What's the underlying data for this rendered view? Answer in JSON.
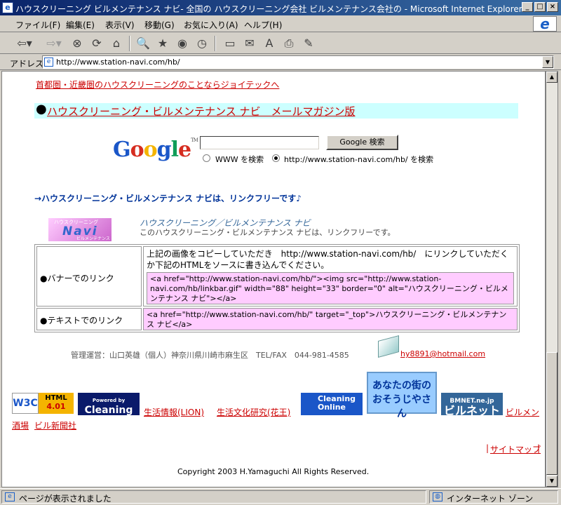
{
  "window": {
    "title": "ハウスクリーニング ビルメンテナンス ナビ- 全国の ハウスクリーニング会社 ビルメンテナンス会社の - Microsoft Internet Explorer"
  },
  "menu": [
    "ファイル(F)",
    "編集(E)",
    "表示(V)",
    "移動(G)",
    "お気に入り(A)",
    "ヘルプ(H)"
  ],
  "address": {
    "label": "アドレス",
    "url": "http://www.station-navi.com/hb/"
  },
  "page": {
    "top_link": "首都圏・近畿圏のハウスクリーニングのことならジョイテックへ",
    "mailmag_link": "ハウスクリーニング・ビルメンテナンス ナビ　メールマガジン版",
    "google": {
      "logo": "Google",
      "button": "Google 検索",
      "opt_www": "WWW を検索",
      "opt_site": "http://www.station-navi.com/hb/ を検索"
    },
    "linkfree_heading": "→ハウスクリーニング・ビルメンテナンス ナビは、リンクフリーです♪",
    "banner": {
      "top": "ハウスクリーニング",
      "main": "Navi",
      "bottom": "ビルメンテナンス",
      "title": "ハウスクリーニング／ビルメンテナンス ナビ",
      "desc": "このハウスクリーニング・ビルメンテナンス ナビは、リンクフリーです。"
    },
    "link_table": {
      "banner_label": "●バナーでのリンク",
      "banner_instr": "上記の画像をコピーしていただき　http://www.station-navi.com/hb/　にリンクしていただくか下記のHTMLをソースに書き込んでください。",
      "banner_code": "<a href=\"http://www.station-navi.com/hb/\"><img src=\"http://www.station-navi.com/hb/linkbar.gif\" width=\"88\" height=\"33\" border=\"0\" alt=\"ハウスクリーニング・ビルメンテナンス ナビ\"></a>",
      "text_label": "●テキストでのリンク",
      "text_code": "<a href=\"http://www.station-navi.com/hb/\" target=\"_top\">ハウスクリーニング・ビルメンテナンス ナビ</a>"
    },
    "admin": "管理運営：山口英雄（個人）神奈川県川崎市麻生区　TEL/FAX　044-981-4585",
    "email": "hy8891@hotmail.com",
    "badges": {
      "w3c": "W3C",
      "html": "HTML",
      "html_ver": "4.01",
      "cn_small": "Powered by",
      "cn_main": "Cleaning Navi",
      "co1": "Cleaning",
      "co2": "Online",
      "anata1": "あなたの街の",
      "anata2": "おそうじやさん",
      "bm1": "BMNET.ne.jp",
      "bm2": "ビルネット"
    },
    "footer_links": [
      "生活情報(LION)",
      "生活文化研究(花王)",
      "ビルメン",
      "酒場",
      "ビル新聞社"
    ],
    "sitemap": "サイトマップ",
    "copyright": "Copyright 2003 H.Yamaguchi All Rights Reserved."
  },
  "status": {
    "left": "ページが表示されました",
    "right": "インターネット ゾーン"
  }
}
